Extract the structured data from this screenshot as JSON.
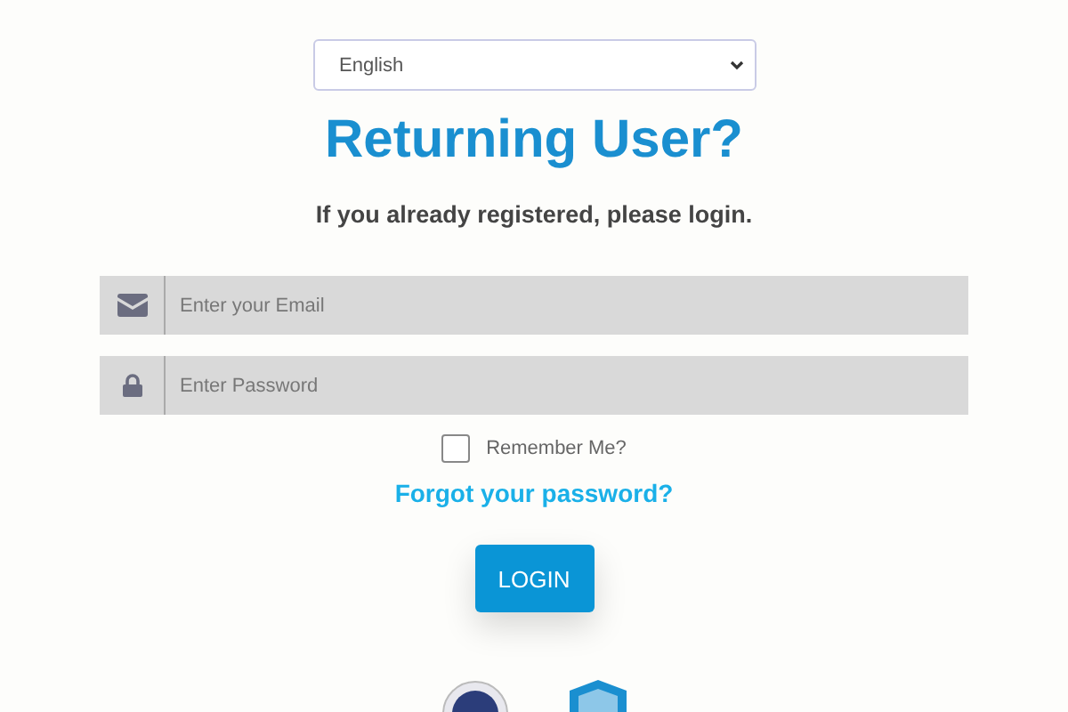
{
  "language_select": {
    "value": "English"
  },
  "heading": "Returning User?",
  "subheading": "If you already registered, please login.",
  "fields": [
    {
      "kind": "email",
      "placeholder": "Enter your Email"
    },
    {
      "kind": "password",
      "placeholder": "Enter Password"
    }
  ],
  "remember": {
    "label": "Remember Me?",
    "checked": false
  },
  "forgot_link": "Forgot your password?",
  "login_button": "LOGIN"
}
